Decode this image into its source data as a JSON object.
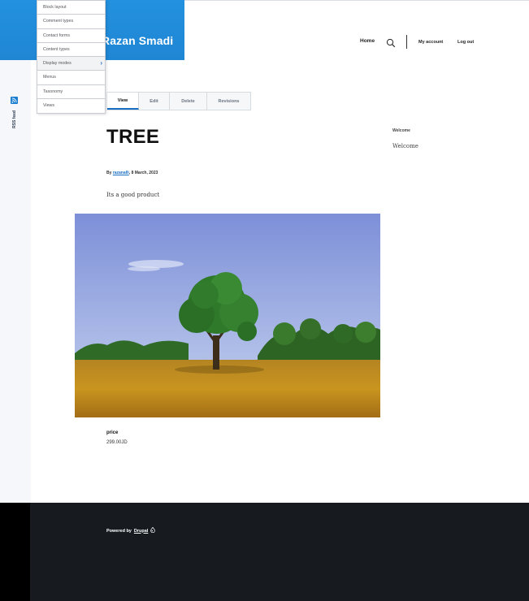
{
  "site": {
    "name": "Razan Smadi"
  },
  "admin_menu": {
    "items": [
      {
        "label": "Block layout"
      },
      {
        "label": "Comment types"
      },
      {
        "label": "Contact forms"
      },
      {
        "label": "Content types"
      },
      {
        "label": "Display modes"
      },
      {
        "label": "Menus"
      },
      {
        "label": "Taxonomy"
      },
      {
        "label": "Views"
      }
    ],
    "submenu_indicator": "›"
  },
  "rss": {
    "label": "RSS feed",
    "icon": "rss-icon"
  },
  "nav": {
    "home": "Home",
    "search_icon": "search-icon",
    "my_account": "My account",
    "log_out": "Log out"
  },
  "tabs": [
    {
      "label": "View"
    },
    {
      "label": "Edit"
    },
    {
      "label": "Delete"
    },
    {
      "label": "Revisions"
    }
  ],
  "node": {
    "title": "TREE",
    "byline_prefix": "By",
    "author": "razanalli",
    "date": ", 8 March, 2023",
    "body": "Its  a good product",
    "image_alt": "Tree in a golden wheat field under a blue sky",
    "price_label": "price",
    "price_value": "299.00JD"
  },
  "sidebar": {
    "heading": "Welcome",
    "text": "Welcome"
  },
  "footer": {
    "powered_by": "Powered by",
    "drupal": "Drupal"
  },
  "colors": {
    "brand_blue": "#1f86d4",
    "link_blue": "#1a6fc2",
    "footer_bg": "#171b20"
  }
}
